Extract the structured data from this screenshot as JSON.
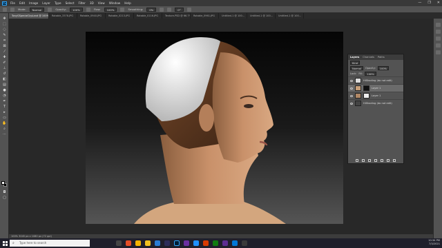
{
  "app": {
    "logo": "Ps"
  },
  "menu": [
    "File",
    "Edit",
    "Image",
    "Layer",
    "Type",
    "Select",
    "Filter",
    "3D",
    "View",
    "Window",
    "Help"
  ],
  "window_controls": [
    "—",
    "❐",
    "✕"
  ],
  "options": {
    "mode_label": "Mode:",
    "mode_value": "Normal",
    "opacity_label": "Opacity:",
    "opacity_value": "100%",
    "flow_label": "Flow:",
    "flow_value": "100%",
    "smoothing_label": "Smoothing:",
    "smoothing_value": "0%",
    "angle_value": "0°"
  },
  "tabs": [
    "TonyGSpecialGrpLand @ 100% (Layer 1, Layer Mask/8)",
    "Rotable_3378.JPG",
    "Rotable_0940.JPG",
    "Rotable_0213.JPG",
    "Rotable_0116.JPG",
    "Texture-PSD @ 66.7% (RG...",
    "Rotable_0961.JPG",
    "Untitled-1 @ 100...",
    "Untitled-1 @ 100...",
    "Untitled-1 @ 100..."
  ],
  "layers_panel": {
    "tabs": [
      "Layers",
      "Channels",
      "Paths"
    ],
    "filter": "Kind",
    "blend": "Normal",
    "opacity_label": "Opacity:",
    "opacity_value": "100%",
    "lock_label": "Lock:",
    "fill_label": "Fill:",
    "fill_value": "100%",
    "layers": [
      {
        "name": "HiShading (do not edit)",
        "thumb": "#dcdcdc",
        "selected": false
      },
      {
        "name": "Layer 1",
        "thumb": "#c8a07a",
        "selected": true
      },
      {
        "name": "Layer 1",
        "thumb": "#b08866",
        "selected": false
      },
      {
        "name": "HiShading (do not edit)",
        "thumb": "#444444",
        "selected": false
      }
    ]
  },
  "status": {
    "text": "100%   3045 px x 1080 px (72 ppi)"
  },
  "taskbar": {
    "search_placeholder": "Type here to search",
    "time": "10:34 PM",
    "date": "7/3/2021"
  },
  "colors": {
    "accent": "#31a8ff",
    "panel": "#535353",
    "workspace": "#282828"
  }
}
